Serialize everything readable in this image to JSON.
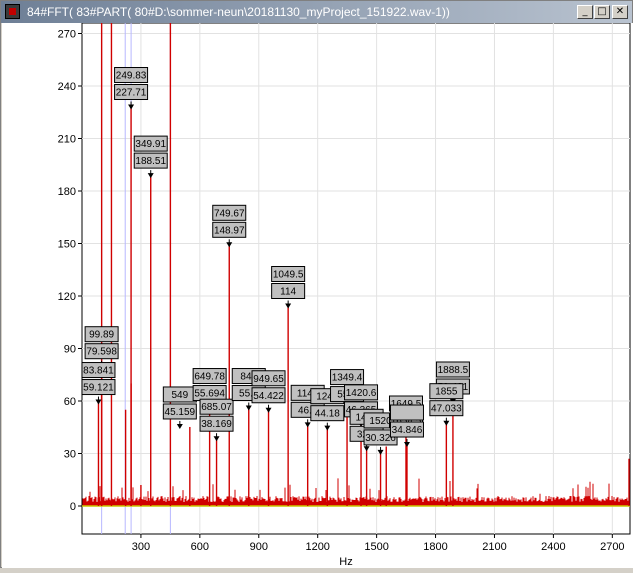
{
  "window": {
    "title": "84#FFT( 83#PART( 80#D:\\sommer-neun\\20181130_myProject_151922.wav-1))",
    "controls": {
      "minimize": "_",
      "maximize": "□",
      "close": "✕"
    }
  },
  "colors": {
    "signal": "#d00000",
    "markers": "#b7b7ff",
    "baseline": "#c8c800",
    "grid": "#e2e2e2",
    "label_fill": "#c0c0c0"
  },
  "chart_data": {
    "type": "line",
    "xlabel": "Hz",
    "ylabel": "",
    "xlim": [
      0,
      2790
    ],
    "ylim": [
      -16,
      276
    ],
    "xticks": [
      300,
      600,
      900,
      1200,
      1500,
      1800,
      2100,
      2400,
      2700
    ],
    "yticks": [
      0,
      30,
      60,
      90,
      120,
      150,
      180,
      210,
      240,
      270
    ],
    "grid": true,
    "marker_lines_x": [
      100,
      220,
      250,
      450
    ],
    "series": [
      {
        "peaks": [
          {
            "x": 100,
            "y": 290
          },
          {
            "x": 150,
            "y": 290
          },
          {
            "x": 450,
            "y": 290
          },
          {
            "x": 222,
            "y": 55
          },
          {
            "x": 250,
            "y": 70
          },
          {
            "x": 300,
            "y": 12
          },
          {
            "x": 99.89,
            "y": 79.598
          },
          {
            "x": 83.841,
            "y": 59.121
          },
          {
            "x": 249.83,
            "y": 227.71
          },
          {
            "x": 349.91,
            "y": 188.51
          },
          {
            "x": 549,
            "y": 45.159
          },
          {
            "x": 649.78,
            "y": 55.694
          },
          {
            "x": 685.07,
            "y": 38.169
          },
          {
            "x": 749.67,
            "y": 148.97
          },
          {
            "x": 849,
            "y": 55.7
          },
          {
            "x": 949.65,
            "y": 54.422
          },
          {
            "x": 1049.5,
            "y": 114
          },
          {
            "x": 1149,
            "y": 46.1
          },
          {
            "x": 1249,
            "y": 44.18
          },
          {
            "x": 1349.4,
            "y": 55.1
          },
          {
            "x": 1420.6,
            "y": 46.365
          },
          {
            "x": 1449,
            "y": 32.4
          },
          {
            "x": 1520,
            "y": 30.326
          },
          {
            "x": 1549,
            "y": 34
          },
          {
            "x": 1649.5,
            "y": 40
          },
          {
            "x": 1654.5,
            "y": 34.846
          },
          {
            "x": 1855,
            "y": 47.033
          },
          {
            "x": 1888.5,
            "y": 59.431
          },
          {
            "x": 2785,
            "y": 27
          }
        ]
      }
    ],
    "annotations": [
      {
        "lines": [
          "249.83",
          "227.71"
        ],
        "x": 249.83,
        "y": 227.71,
        "dx": 0,
        "dy": 0
      },
      {
        "lines": [
          "349.91",
          "188.51"
        ],
        "x": 349.91,
        "y": 188.51,
        "dx": 0,
        "dy": 0
      },
      {
        "lines": [
          "99.89",
          "79.598"
        ],
        "x": 99.89,
        "y": 79.598,
        "dx": 0,
        "dy": 0
      },
      {
        "lines": [
          "83.841",
          "59.121"
        ],
        "x": 83.841,
        "y": 59.121,
        "dx": 0,
        "dy": 0
      },
      {
        "lines": [
          "549",
          "45.159"
        ],
        "x": 549,
        "y": 45.159,
        "dx": -10,
        "dy": 0
      },
      {
        "lines": [
          "649.78",
          "55.694"
        ],
        "x": 649.78,
        "y": 55.694,
        "dx": 0,
        "dy": 0
      },
      {
        "lines": [
          "685.07",
          "38.169"
        ],
        "x": 685.07,
        "y": 38.169,
        "dx": 0,
        "dy": 0
      },
      {
        "lines": [
          "749.67",
          "148.97"
        ],
        "x": 749.67,
        "y": 148.97,
        "dx": 0,
        "dy": 0
      },
      {
        "lines": [
          "849",
          "55.7"
        ],
        "x": 849,
        "y": 55.7,
        "dx": 0,
        "dy": 0
      },
      {
        "lines": [
          "949.65",
          "54.422"
        ],
        "x": 949.65,
        "y": 54.422,
        "dx": 0,
        "dy": 0
      },
      {
        "lines": [
          "1049.5",
          "114"
        ],
        "x": 1049.5,
        "y": 114,
        "dx": 0,
        "dy": 0
      },
      {
        "lines": [
          "1149",
          "46.1"
        ],
        "x": 1149,
        "y": 46.1,
        "dx": 0,
        "dy": 0
      },
      {
        "lines": [
          "1249",
          "44.18"
        ],
        "x": 1249,
        "y": 44.18,
        "dx": 0,
        "dy": 0
      },
      {
        "lines": [
          "1349.4",
          "55.1"
        ],
        "x": 1349.4,
        "y": 55.1,
        "dx": 0,
        "dy": 0
      },
      {
        "lines": [
          "1420.6",
          "46.365"
        ],
        "x": 1420.6,
        "y": 46.365,
        "dx": 0,
        "dy": 0
      },
      {
        "lines": [
          "1449",
          "32.4"
        ],
        "x": 1449,
        "y": 32.4,
        "dx": 0,
        "dy": 0
      },
      {
        "lines": [
          "1520",
          "30.326"
        ],
        "x": 1520,
        "y": 30.326,
        "dx": 0,
        "dy": 0
      },
      {
        "lines": [
          "1649.5",
          "1654.5"
        ],
        "x": 1649.5,
        "y": 40,
        "dx": 0,
        "dy": 0
      },
      {
        "lines": [
          "",
          "34.846"
        ],
        "x": 1654.5,
        "y": 34.846,
        "dx": 0,
        "dy": 0
      },
      {
        "lines": [
          "1888.5",
          "59.431"
        ],
        "x": 1888.5,
        "y": 59.431,
        "dx": 0,
        "dy": 0
      },
      {
        "lines": [
          "1855",
          "47.033"
        ],
        "x": 1855,
        "y": 47.033,
        "dx": 0,
        "dy": 0
      }
    ]
  }
}
